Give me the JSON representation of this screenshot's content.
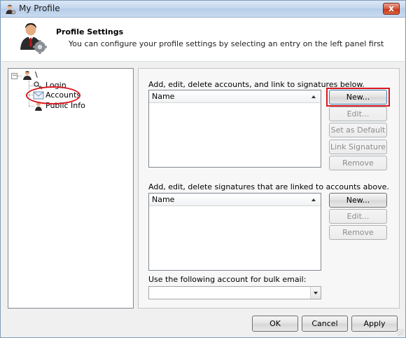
{
  "window": {
    "title": "My Profile",
    "close_glyph": "x"
  },
  "header": {
    "title": "Profile Settings",
    "subtitle": "You can configure your profile settings by selecting an entry on the left panel first"
  },
  "tree": {
    "root_label": "\\",
    "expander_glyph": "−",
    "items": [
      {
        "label": "Login",
        "icon": "key-icon"
      },
      {
        "label": "Accounts",
        "icon": "envelope-icon"
      },
      {
        "label": "Public Info",
        "icon": "user-card-icon"
      }
    ]
  },
  "accounts": {
    "instruction": "Add, edit, delete accounts, and link to signatures below.",
    "column_header": "Name",
    "buttons": {
      "new": "New...",
      "edit": "Edit...",
      "set_default": "Set as Default",
      "link_signature": "Link Signature",
      "remove": "Remove"
    }
  },
  "signatures": {
    "instruction": "Add, edit, delete signatures that are linked to accounts above.",
    "column_header": "Name",
    "buttons": {
      "new": "New...",
      "edit": "Edit...",
      "remove": "Remove"
    }
  },
  "bulk_email": {
    "label": "Use the following account for bulk email:",
    "selected": ""
  },
  "footer": {
    "ok": "OK",
    "cancel": "Cancel",
    "apply": "Apply"
  },
  "colors": {
    "highlight_red": "#d71920",
    "title_bar": "#c5d8ee"
  }
}
